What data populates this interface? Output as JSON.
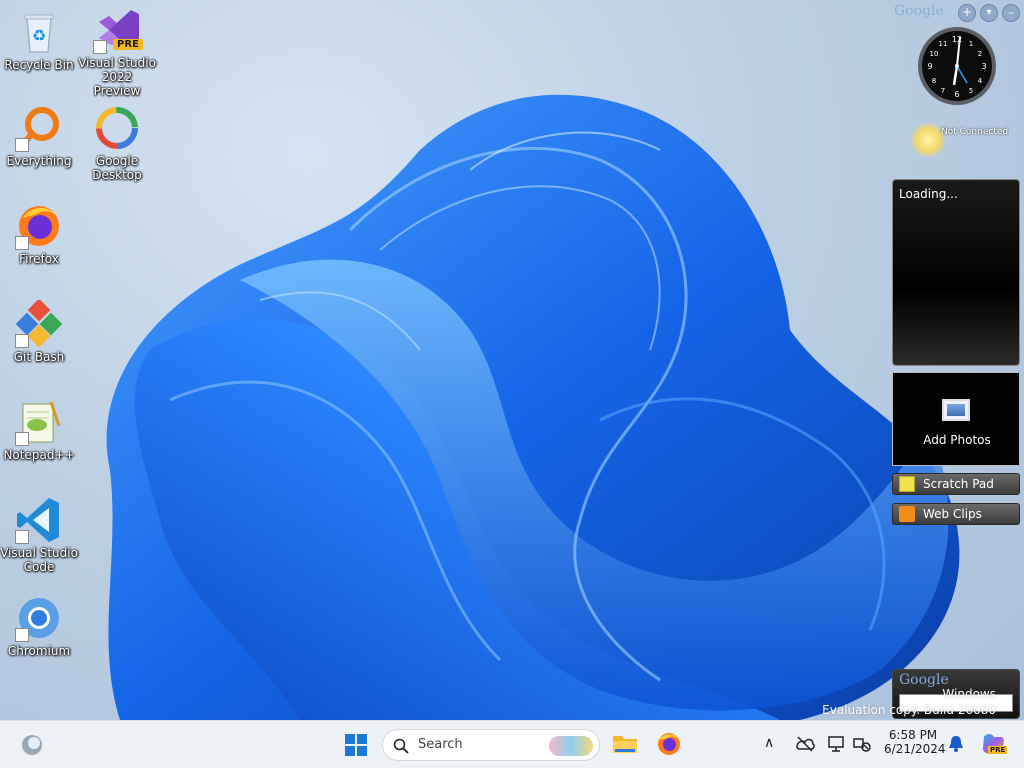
{
  "desktop_icons": [
    {
      "label": "Recycle Bin",
      "icon": "recycle-bin-icon"
    },
    {
      "label": "Visual Studio 2022 Preview",
      "icon": "visual-studio-icon",
      "badge": "PRE"
    },
    {
      "label": "Everything",
      "icon": "everything-search-icon"
    },
    {
      "label": "Google Desktop",
      "icon": "google-desktop-icon"
    },
    {
      "label": "Firefox",
      "icon": "firefox-icon"
    },
    {
      "label": "Git Bash",
      "icon": "git-bash-icon"
    },
    {
      "label": "Notepad++",
      "icon": "notepad-plus-plus-icon"
    },
    {
      "label": "Visual Studio Code",
      "icon": "vscode-icon"
    },
    {
      "label": "Chromium",
      "icon": "chromium-icon"
    }
  ],
  "sidebar": {
    "logo": "Google",
    "buttons": [
      "+",
      "▾",
      "–"
    ],
    "status": "Not Connected",
    "loading_panel": "Loading...",
    "photos_label": "Add Photos",
    "scratch_pad": "Scratch Pad",
    "web_clips": "Web Clips",
    "search_logo": "Google"
  },
  "watermark": {
    "line1": "Windows",
    "line2": "Evaluation copy. Build 26080"
  },
  "taskbar": {
    "search_placeholder": "Search",
    "time": "6:58 PM",
    "date": "6/21/2024",
    "copilot_badge": "PRE"
  },
  "colors": {
    "accent": "#0a5cd6",
    "taskbar_bg": "#eef2f7",
    "wallpaper_blue": "#1a6df0"
  }
}
